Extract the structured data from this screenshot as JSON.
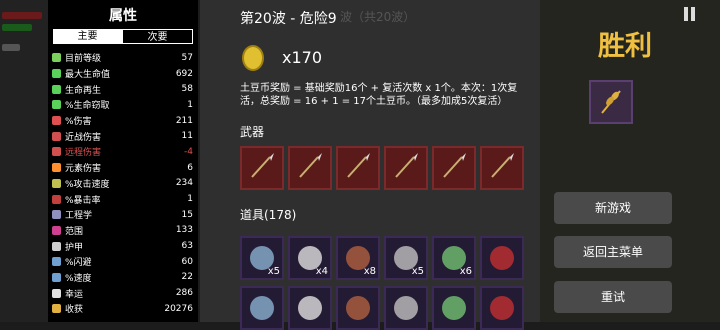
{
  "stats_panel": {
    "title": "属性",
    "tabs": {
      "primary": "主要",
      "secondary": "次要"
    },
    "rows": [
      {
        "label": "目前等级",
        "value": "57",
        "icon": "level-icon",
        "color": "#7ccf5a",
        "neg": false
      },
      {
        "label": "最大生命值",
        "value": "692",
        "icon": "heart-icon",
        "color": "#5ad25a",
        "neg": false
      },
      {
        "label": "生命再生",
        "value": "58",
        "icon": "regen-icon",
        "color": "#5ad25a",
        "neg": false
      },
      {
        "label": "%生命窃取",
        "value": "1",
        "icon": "lifesteal-icon",
        "color": "#5ad25a",
        "neg": false
      },
      {
        "label": "%伤害",
        "value": "211",
        "icon": "damage-icon",
        "color": "#e05050",
        "neg": false
      },
      {
        "label": "近战伤害",
        "value": "11",
        "icon": "melee-icon",
        "color": "#d05050",
        "neg": false
      },
      {
        "label": "远程伤害",
        "value": "-4",
        "icon": "ranged-icon",
        "color": "#d05050",
        "neg": true
      },
      {
        "label": "元素伤害",
        "value": "6",
        "icon": "elemental-icon",
        "color": "#ff9030",
        "neg": false
      },
      {
        "label": "%攻击速度",
        "value": "234",
        "icon": "attack-speed-icon",
        "color": "#c0c050",
        "neg": false
      },
      {
        "label": "%暴击率",
        "value": "1",
        "icon": "crit-icon",
        "color": "#c04040",
        "neg": false
      },
      {
        "label": "工程学",
        "value": "15",
        "icon": "engineering-icon",
        "color": "#9090c0",
        "neg": false
      },
      {
        "label": "范围",
        "value": "133",
        "icon": "range-icon",
        "color": "#d04090",
        "neg": false
      },
      {
        "label": "护甲",
        "value": "63",
        "icon": "armor-icon",
        "color": "#d0d0d0",
        "neg": false
      },
      {
        "label": "%闪避",
        "value": "60",
        "icon": "dodge-icon",
        "color": "#70a0d0",
        "neg": false
      },
      {
        "label": "%速度",
        "value": "22",
        "icon": "speed-icon",
        "color": "#70a0d0",
        "neg": false
      },
      {
        "label": "幸运",
        "value": "286",
        "icon": "luck-icon",
        "color": "#e0e0e0",
        "neg": false
      },
      {
        "label": "收获",
        "value": "20276",
        "icon": "harvest-icon",
        "color": "#e0b040",
        "neg": false
      }
    ]
  },
  "main_panel": {
    "wave_title": "第20波 - 危险9",
    "wave_ghost": "波（共20波）",
    "coins": "x170",
    "reward_desc": "土豆币奖励 = 基础奖励16个 + 复活次数 x 1个。本次：1次复活，总奖励 = 16 + 1 = 17个土豆币。（最多加成5次复活）",
    "weapons_title": "武器",
    "weapons": [
      {
        "icon": "spear-icon"
      },
      {
        "icon": "spear-icon"
      },
      {
        "icon": "spear-icon"
      },
      {
        "icon": "spear-icon"
      },
      {
        "icon": "spear-icon"
      },
      {
        "icon": "spear-icon"
      }
    ],
    "items_title": "道具(178)",
    "items_row1": [
      {
        "icon": "rope-icon",
        "count": "x5"
      },
      {
        "icon": "cat-icon",
        "count": "x4"
      },
      {
        "icon": "cake-icon",
        "count": "x8"
      },
      {
        "icon": "helmet-icon",
        "count": "x5"
      },
      {
        "icon": "tractor-icon",
        "count": "x6"
      },
      {
        "icon": "bomb-icon",
        "count": ""
      }
    ],
    "items_row2": [
      {
        "icon": "mask-icon"
      },
      {
        "icon": "bones-icon"
      },
      {
        "icon": "pig-icon"
      },
      {
        "icon": "skull-icon"
      },
      {
        "icon": "bunny-icon"
      },
      {
        "icon": "potion-icon"
      }
    ]
  },
  "right_panel": {
    "victory": "胜利",
    "reward_item": "wheat-icon",
    "buttons": {
      "new_game": "新游戏",
      "main_menu": "返回主菜单",
      "retry": "重试"
    }
  }
}
